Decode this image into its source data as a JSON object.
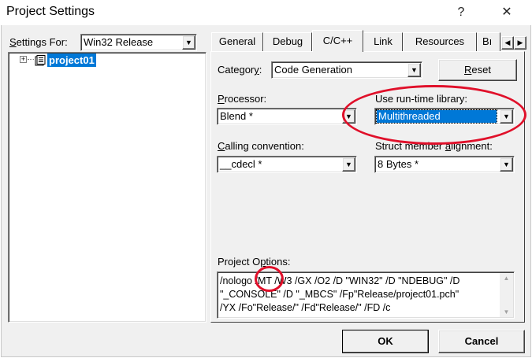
{
  "window": {
    "title": "Project Settings",
    "help_glyph": "?",
    "close_glyph": "✕"
  },
  "left": {
    "settings_for_label": "Settings For:",
    "settings_for_value": "Win32 Release",
    "tree": {
      "expander": "+",
      "project_name": "project01"
    }
  },
  "tabs": [
    "General",
    "Debug",
    "C/C++",
    "Link",
    "Resources",
    "Bı"
  ],
  "active_tab": "C/C++",
  "panel": {
    "category_label": "Category:",
    "category_value": "Code Generation",
    "reset_label": "Reset",
    "processor_label": "Processor:",
    "processor_value": "Blend *",
    "runtime_label": "Use run-time library:",
    "runtime_value": "Multithreaded",
    "calling_label": "Calling convention:",
    "calling_value": "__cdecl *",
    "struct_label": "Struct member alignment:",
    "struct_value": "8 Bytes *",
    "options_label": "Project Options:",
    "options_lines": [
      "/nologo /MT /W3 /GX /O2 /D \"WIN32\" /D \"NDEBUG\" /D",
      "\"_CONSOLE\" /D \"_MBCS\" /Fp\"Release/project01.pch\"",
      "/YX /Fo\"Release/\" /Fd\"Release/\" /FD /c"
    ]
  },
  "buttons": {
    "ok": "OK",
    "cancel": "Cancel"
  },
  "colors": {
    "selection": "#0078d7",
    "annotation": "#e0102a"
  }
}
